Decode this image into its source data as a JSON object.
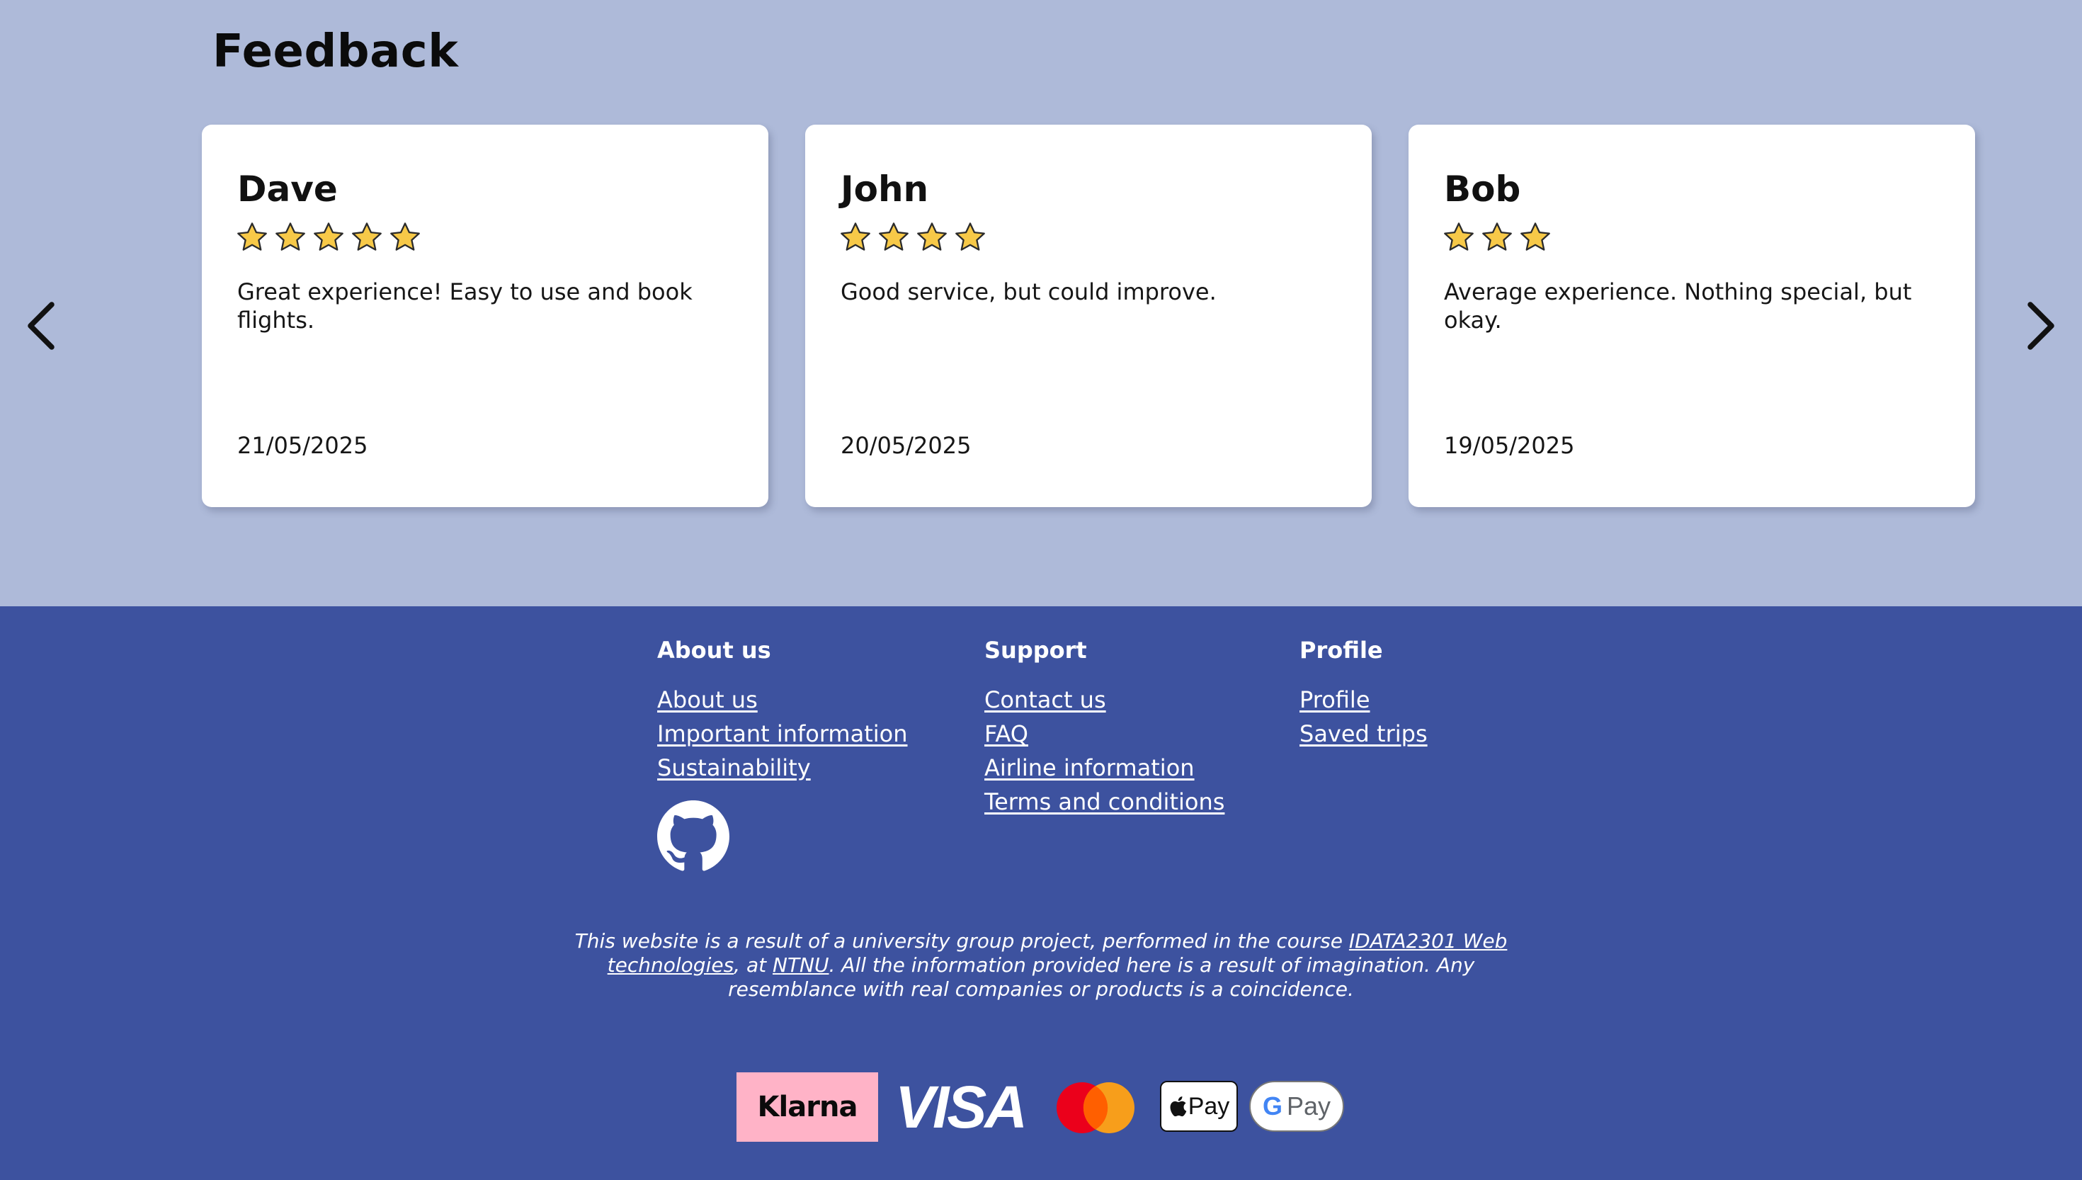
{
  "feedback": {
    "title": "Feedback",
    "cards": [
      {
        "name": "Dave",
        "rating": 5,
        "text": "Great experience! Easy to use and book flights.",
        "date": "21/05/2025"
      },
      {
        "name": "John",
        "rating": 4,
        "text": "Good service, but could improve.",
        "date": "20/05/2025"
      },
      {
        "name": "Bob",
        "rating": 3,
        "text": "Average experience. Nothing special, but okay.",
        "date": "19/05/2025"
      }
    ],
    "prev_icon": "chevron-left-icon",
    "next_icon": "chevron-right-icon"
  },
  "footer": {
    "columns": [
      {
        "heading": "About us",
        "links": [
          "About us",
          "Important information",
          "Sustainability"
        ]
      },
      {
        "heading": "Support",
        "links": [
          "Contact us",
          "FAQ",
          "Airline information",
          "Terms and conditions"
        ]
      },
      {
        "heading": "Profile",
        "links": [
          "Profile",
          "Saved trips"
        ]
      }
    ],
    "github_icon": "github-icon",
    "disclaimer": {
      "part1": "This website is a result of a university group project, performed in the course ",
      "course_link": "IDATA2301 Web technologies",
      "part2": ", at ",
      "ntnu_link": "NTNU",
      "part3": ". All the information provided here is a result of imagination. Any resemblance with real companies or products is a coincidence."
    },
    "payments": {
      "klarna": "Klarna",
      "visa": "VISA",
      "applepay": "Pay",
      "gpay": "Pay",
      "gpay_g": "G"
    }
  },
  "colors": {
    "feedback_bg": "#aebad9",
    "footer_bg": "#3d529f",
    "star_fill": "#f7c948",
    "klarna_pink": "#ffb3c7"
  }
}
